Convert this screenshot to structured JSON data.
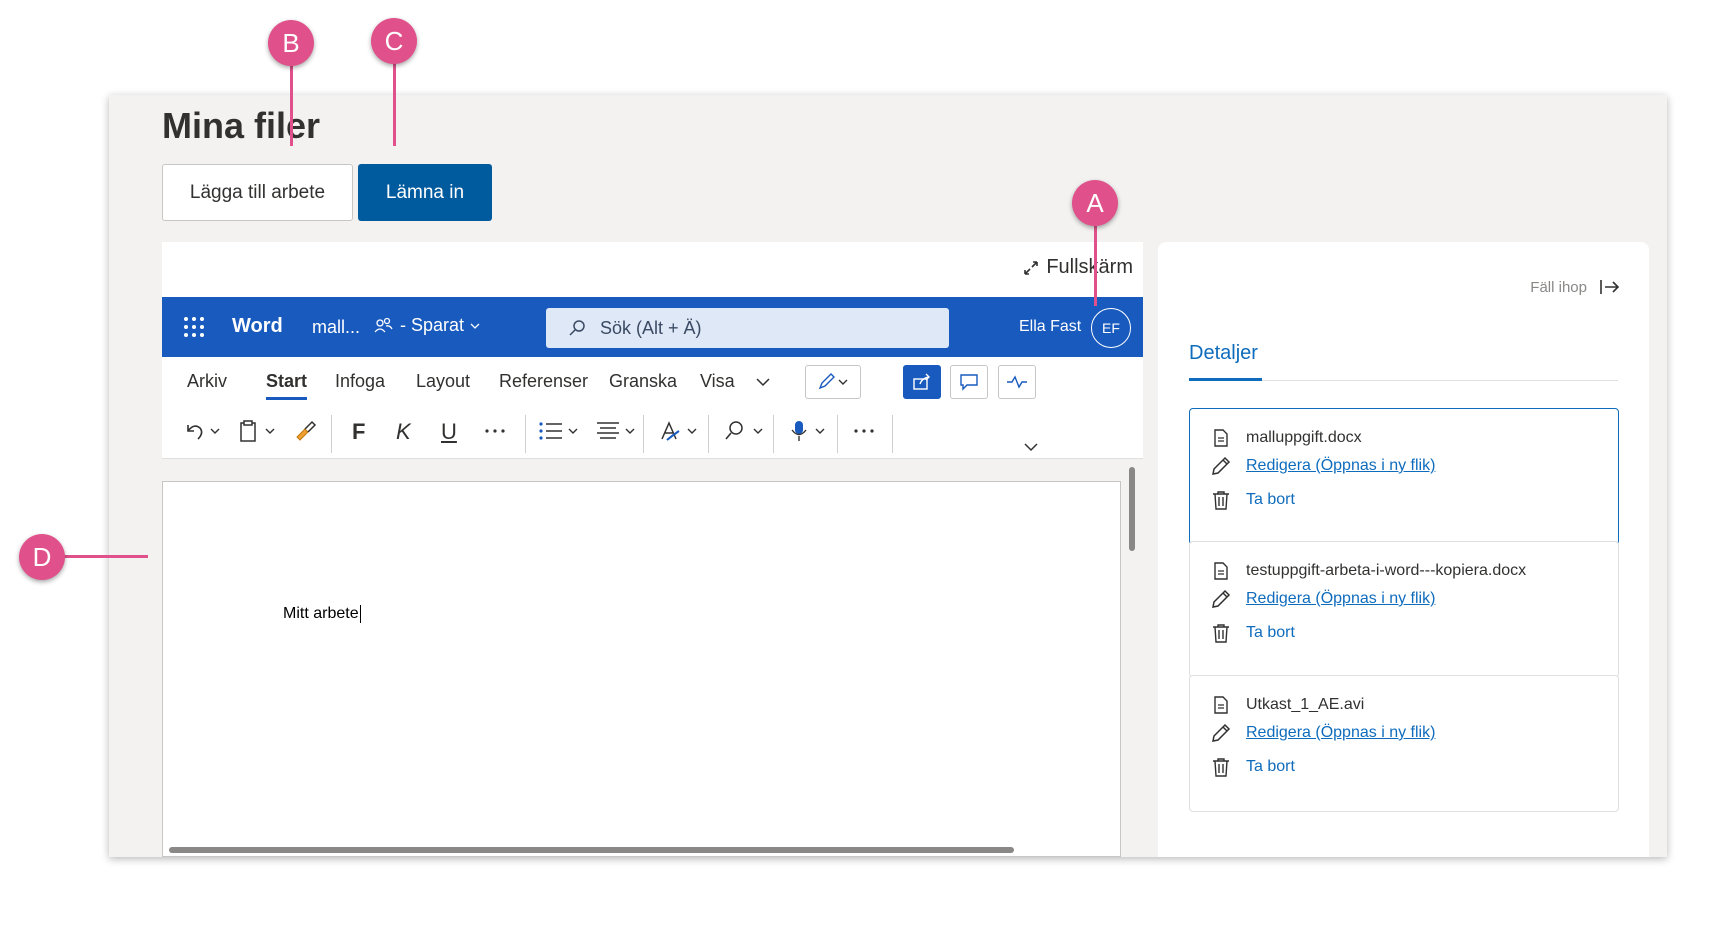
{
  "page": {
    "title": "Mina filer",
    "add_button": "Lägga till arbete",
    "submit_button": "Lämna in"
  },
  "editor": {
    "fullscreen_label": "Fullskärm",
    "app_name": "Word",
    "doc_name": "mall...",
    "saved_status": "- Sparat",
    "search_placeholder": "Sök (Alt + Ä)",
    "user_name": "Ella Fast",
    "user_initials": "EF",
    "ribbon_tabs": [
      "Arkiv",
      "Start",
      "Infoga",
      "Layout",
      "Referenser",
      "Granska",
      "Visa"
    ],
    "active_tab": "Start",
    "format_bold": "F",
    "format_italic": "K",
    "format_underline": "U",
    "document_text": "Mitt arbete"
  },
  "panel": {
    "collapse_label": "Fäll ihop",
    "details_tab": "Detaljer",
    "files": [
      {
        "name": "malluppgift.docx",
        "edit_label": "Redigera (Öppnas i ny flik)",
        "delete_label": "Ta bort"
      },
      {
        "name": "testuppgift-arbeta-i-word---kopiera.docx",
        "edit_label": "Redigera (Öppnas i ny flik)",
        "delete_label": "Ta bort"
      },
      {
        "name": "Utkast_1_AE.avi",
        "edit_label": "Redigera (Öppnas i ny flik)",
        "delete_label": "Ta bort"
      }
    ]
  },
  "callouts": {
    "a": "A",
    "b": "B",
    "c": "C",
    "d": "D"
  },
  "colors": {
    "callout": "#e0508a",
    "word_blue": "#185abd",
    "primary_button": "#005a9e",
    "link": "#0f6cbd"
  }
}
